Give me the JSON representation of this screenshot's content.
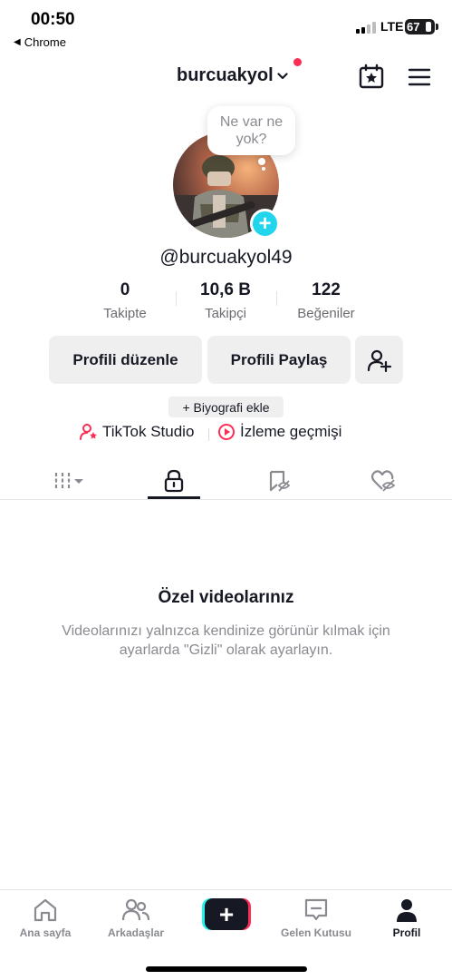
{
  "status_bar": {
    "time": "00:50",
    "back_app": "Chrome",
    "network": "LTE",
    "battery": "67"
  },
  "header": {
    "username": "burcuakyol"
  },
  "bubble": {
    "line1": "Ne var ne",
    "line2": "yok?"
  },
  "profile": {
    "handle": "@burcuakyol49"
  },
  "stats": [
    {
      "value": "0",
      "label": "Takipte"
    },
    {
      "value": "10,6 B",
      "label": "Takipçi"
    },
    {
      "value": "122",
      "label": "Beğeniler"
    }
  ],
  "buttons": {
    "edit": "Profili düzenle",
    "share": "Profili Paylaş"
  },
  "bio": {
    "add": "+ Biyografi ekle"
  },
  "links": {
    "studio": "TikTok Studio",
    "history": "İzleme geçmişi"
  },
  "empty": {
    "title": "Özel videolarınız",
    "desc": "Videolarınızı yalnızca kendinize görünür kılmak için ayarlarda \"Gizli\" olarak ayarlayın."
  },
  "nav": [
    {
      "label": "Ana sayfa",
      "icon": "home-icon"
    },
    {
      "label": "Arkadaşlar",
      "icon": "friends-icon"
    },
    {
      "label": "",
      "icon": "create-icon"
    },
    {
      "label": "Gelen Kutusu",
      "icon": "inbox-icon"
    },
    {
      "label": "Profil",
      "icon": "profile-icon"
    }
  ],
  "colors": {
    "accent": "#fe2c55",
    "cyan": "#20d5ec",
    "text": "#161823",
    "muted": "#8a8b91",
    "button_bg": "#efeff0"
  }
}
